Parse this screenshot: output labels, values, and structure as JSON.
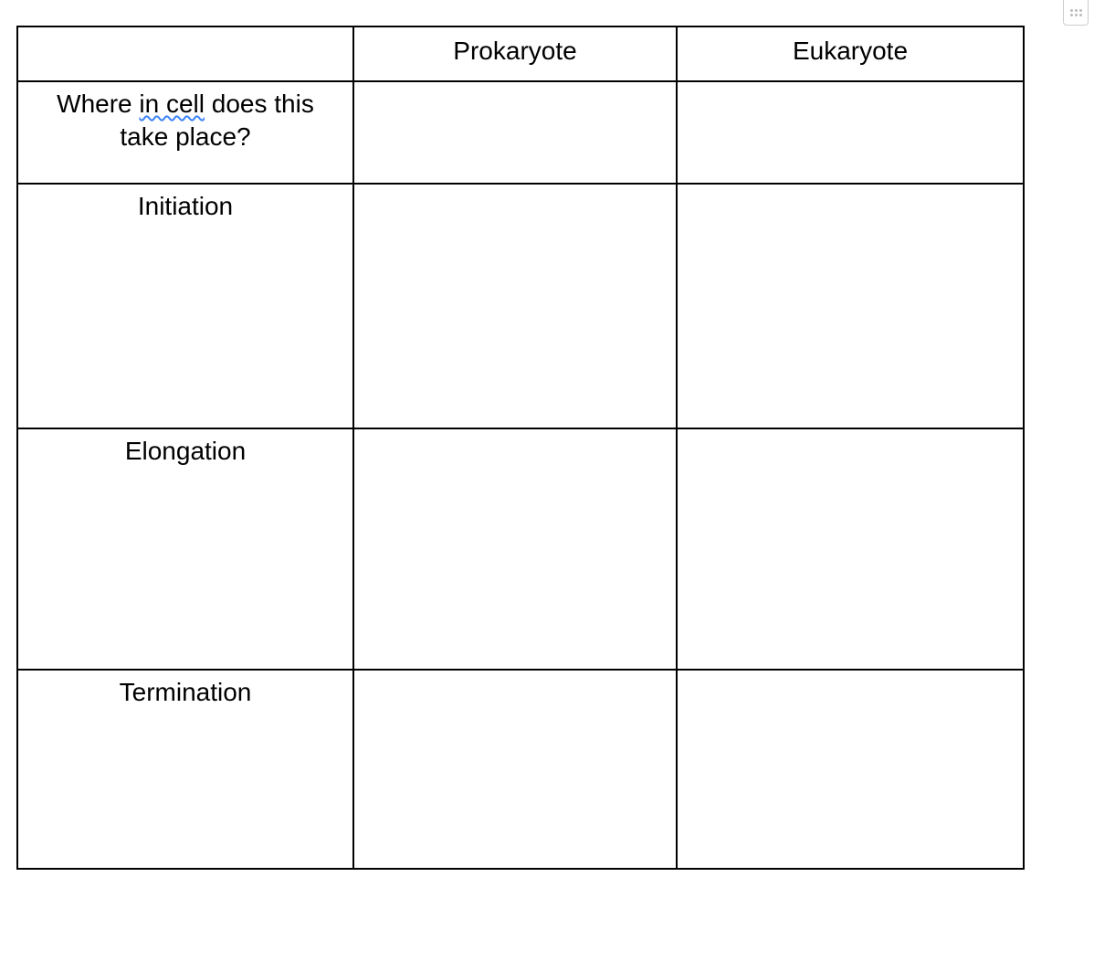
{
  "corner_widget": {
    "name": "drag-handle"
  },
  "table": {
    "header": {
      "col0": "",
      "col1": "Prokaryote",
      "col2": "Eukaryote"
    },
    "rows": [
      {
        "label_pre": "Where ",
        "label_flag": "in cell",
        "label_post": " does this",
        "label_line2": "take place?",
        "prokaryote": "",
        "eukaryote": ""
      },
      {
        "label": "Initiation",
        "prokaryote": "",
        "eukaryote": ""
      },
      {
        "label": "Elongation",
        "prokaryote": "",
        "eukaryote": ""
      },
      {
        "label": "Termination",
        "prokaryote": "",
        "eukaryote": ""
      }
    ]
  }
}
